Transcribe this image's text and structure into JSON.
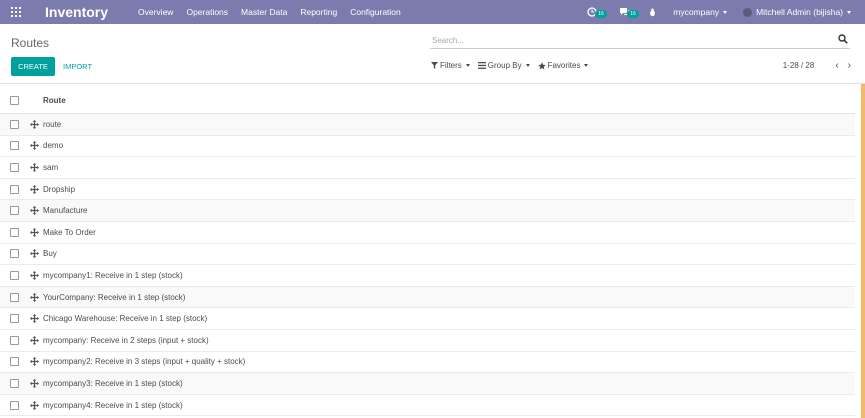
{
  "navbar": {
    "app_name": "Inventory",
    "menu": [
      "Overview",
      "Operations",
      "Master Data",
      "Reporting",
      "Configuration"
    ],
    "activity_count": "16",
    "messages_count": "16",
    "company": "mycompany",
    "user": "Mitchell Admin (bijisha)"
  },
  "control_panel": {
    "title": "Routes",
    "create_label": "CREATE",
    "import_label": "IMPORT",
    "search_placeholder": "Search...",
    "filters_label": "Filters",
    "groupby_label": "Group By",
    "favorites_label": "Favorites",
    "pager_value": "1-28 / 28"
  },
  "list": {
    "header": "Route",
    "rows": [
      "route",
      "demo",
      "sam",
      "Dropship",
      "Manufacture",
      "Make To Order",
      "Buy",
      "mycompany1: Receive in 1 step (stock)",
      "YourCompany: Receive in 1 step (stock)",
      "Chicago Warehouse: Receive in 1 step (stock)",
      "mycompany: Receive in 2 steps (input + stock)",
      "mycompany2: Receive in 3 steps (input + quality + stock)",
      "mycompany3: Receive in 1 step (stock)",
      "mycompany4: Receive in 1 step (stock)"
    ]
  },
  "colors": {
    "navbar": "#7c7bad",
    "primary": "#00a09d",
    "scrollbar": "#f0ad4e"
  }
}
